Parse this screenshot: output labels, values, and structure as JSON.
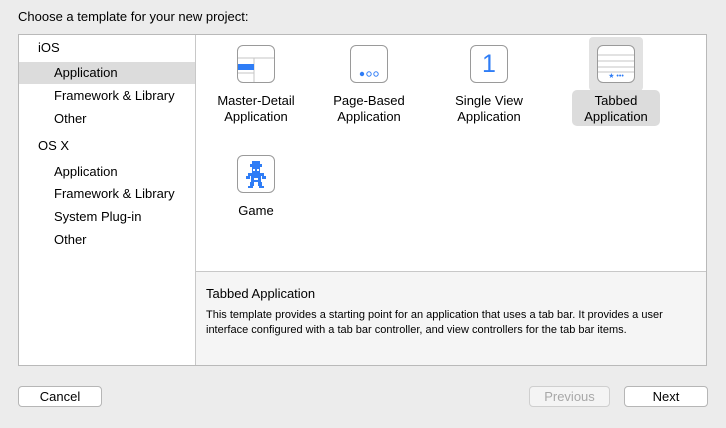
{
  "heading": "Choose a template for your new project:",
  "sidebar": {
    "groups": [
      {
        "title": "iOS",
        "items": [
          "Application",
          "Framework & Library",
          "Other"
        ]
      },
      {
        "title": "OS X",
        "items": [
          "Application",
          "Framework & Library",
          "System Plug-in",
          "Other"
        ]
      }
    ],
    "selected": "iOS / Application"
  },
  "templates": [
    {
      "label_line1": "Master-Detail",
      "label_line2": "Application",
      "icon": "master-detail-icon"
    },
    {
      "label_line1": "Page-Based",
      "label_line2": "Application",
      "icon": "page-based-icon"
    },
    {
      "label_line1": "Single View",
      "label_line2": "Application",
      "icon": "single-view-icon",
      "glyph": "1"
    },
    {
      "label_line1": "Tabbed",
      "label_line2": "Application",
      "icon": "tabbed-icon",
      "glyph": "★ •••"
    },
    {
      "label_line1": "Game",
      "label_line2": "",
      "icon": "game-icon"
    }
  ],
  "selected_template": "Tabbed Application",
  "description": {
    "title": "Tabbed Application",
    "text": "This template provides a starting point for an application that uses a tab bar. It provides a user interface configured with a tab bar controller, and view controllers for the tab bar items."
  },
  "buttons": {
    "cancel": "Cancel",
    "previous": "Previous",
    "next": "Next"
  },
  "colors": {
    "accent": "#2f7df6",
    "selection": "#dcdcdc"
  }
}
